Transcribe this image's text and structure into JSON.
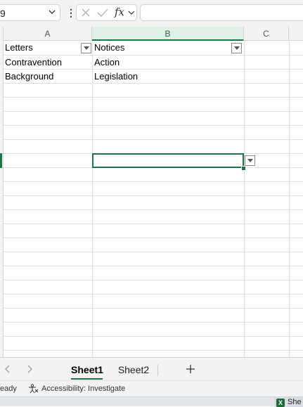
{
  "formula_bar": {
    "name_box_value": "9",
    "fx_label": "fx",
    "formula_value": ""
  },
  "columns": [
    {
      "letter": "A"
    },
    {
      "letter": "B"
    },
    {
      "letter": "C"
    }
  ],
  "table": {
    "headers": [
      "Letters",
      "Notices"
    ],
    "rows": [
      [
        "Contravention",
        "Action"
      ],
      [
        "Background",
        "Legislation"
      ]
    ]
  },
  "sheet_tabs": {
    "tabs": [
      "Sheet1",
      "Sheet2"
    ],
    "active": "Sheet1",
    "add_symbol": "+"
  },
  "status_bar": {
    "ready": "eady",
    "accessibility": "Accessibility: Investigate"
  },
  "taskbar": {
    "app_label": "She",
    "app_icon_letter": "X"
  },
  "colors": {
    "accent": "#217346",
    "header_bg": "#f3f3f3",
    "gridline": "#e1e1e1"
  }
}
